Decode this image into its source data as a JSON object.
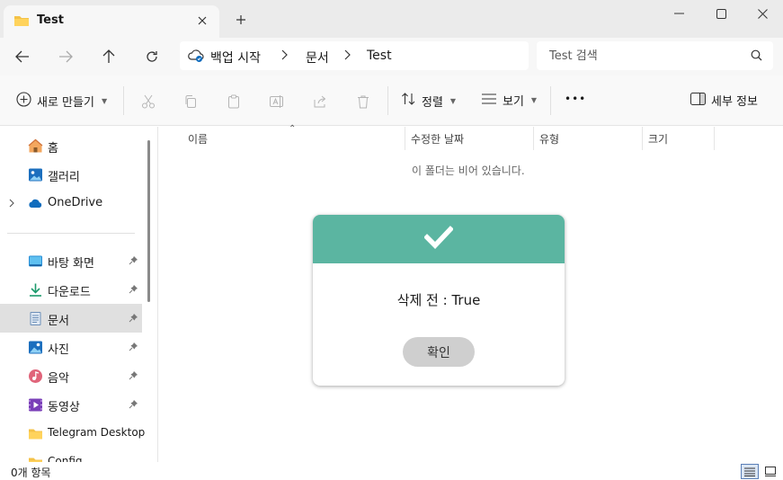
{
  "window": {
    "tab_title": "Test",
    "new_tab_icon": "plus-icon",
    "minimize_icon": "minimize-icon",
    "maximize_icon": "maximize-icon",
    "close_icon": "close-icon"
  },
  "address": {
    "breadcrumb": [
      "백업 시작",
      "문서",
      "Test"
    ],
    "search_placeholder": "Test 검색"
  },
  "toolbar": {
    "new_label": "새로 만들기",
    "sort_label": "정렬",
    "view_label": "보기",
    "more_label": "•••",
    "details_label": "세부 정보"
  },
  "sidebar": {
    "items": [
      {
        "label": "홈",
        "icon": "home-icon"
      },
      {
        "label": "갤러리",
        "icon": "gallery-icon"
      },
      {
        "label": "OneDrive",
        "icon": "cloud-icon"
      },
      {
        "label": "바탕 화면",
        "icon": "desktop-icon"
      },
      {
        "label": "다운로드",
        "icon": "download-icon"
      },
      {
        "label": "문서",
        "icon": "document-icon"
      },
      {
        "label": "사진",
        "icon": "pictures-icon"
      },
      {
        "label": "음악",
        "icon": "music-icon"
      },
      {
        "label": "동영상",
        "icon": "video-icon"
      },
      {
        "label": "Telegram Desktop",
        "icon": "folder-icon"
      },
      {
        "label": "Config",
        "icon": "folder-icon"
      }
    ]
  },
  "content": {
    "columns": [
      "이름",
      "수정한 날짜",
      "유형",
      "크기"
    ],
    "empty_message": "이 폴더는 비어 있습니다."
  },
  "status": {
    "item_count": "0개 항목"
  },
  "dialog": {
    "message": "삭제 전 : True",
    "confirm_label": "확인",
    "header_color": "#5bb5a1"
  }
}
